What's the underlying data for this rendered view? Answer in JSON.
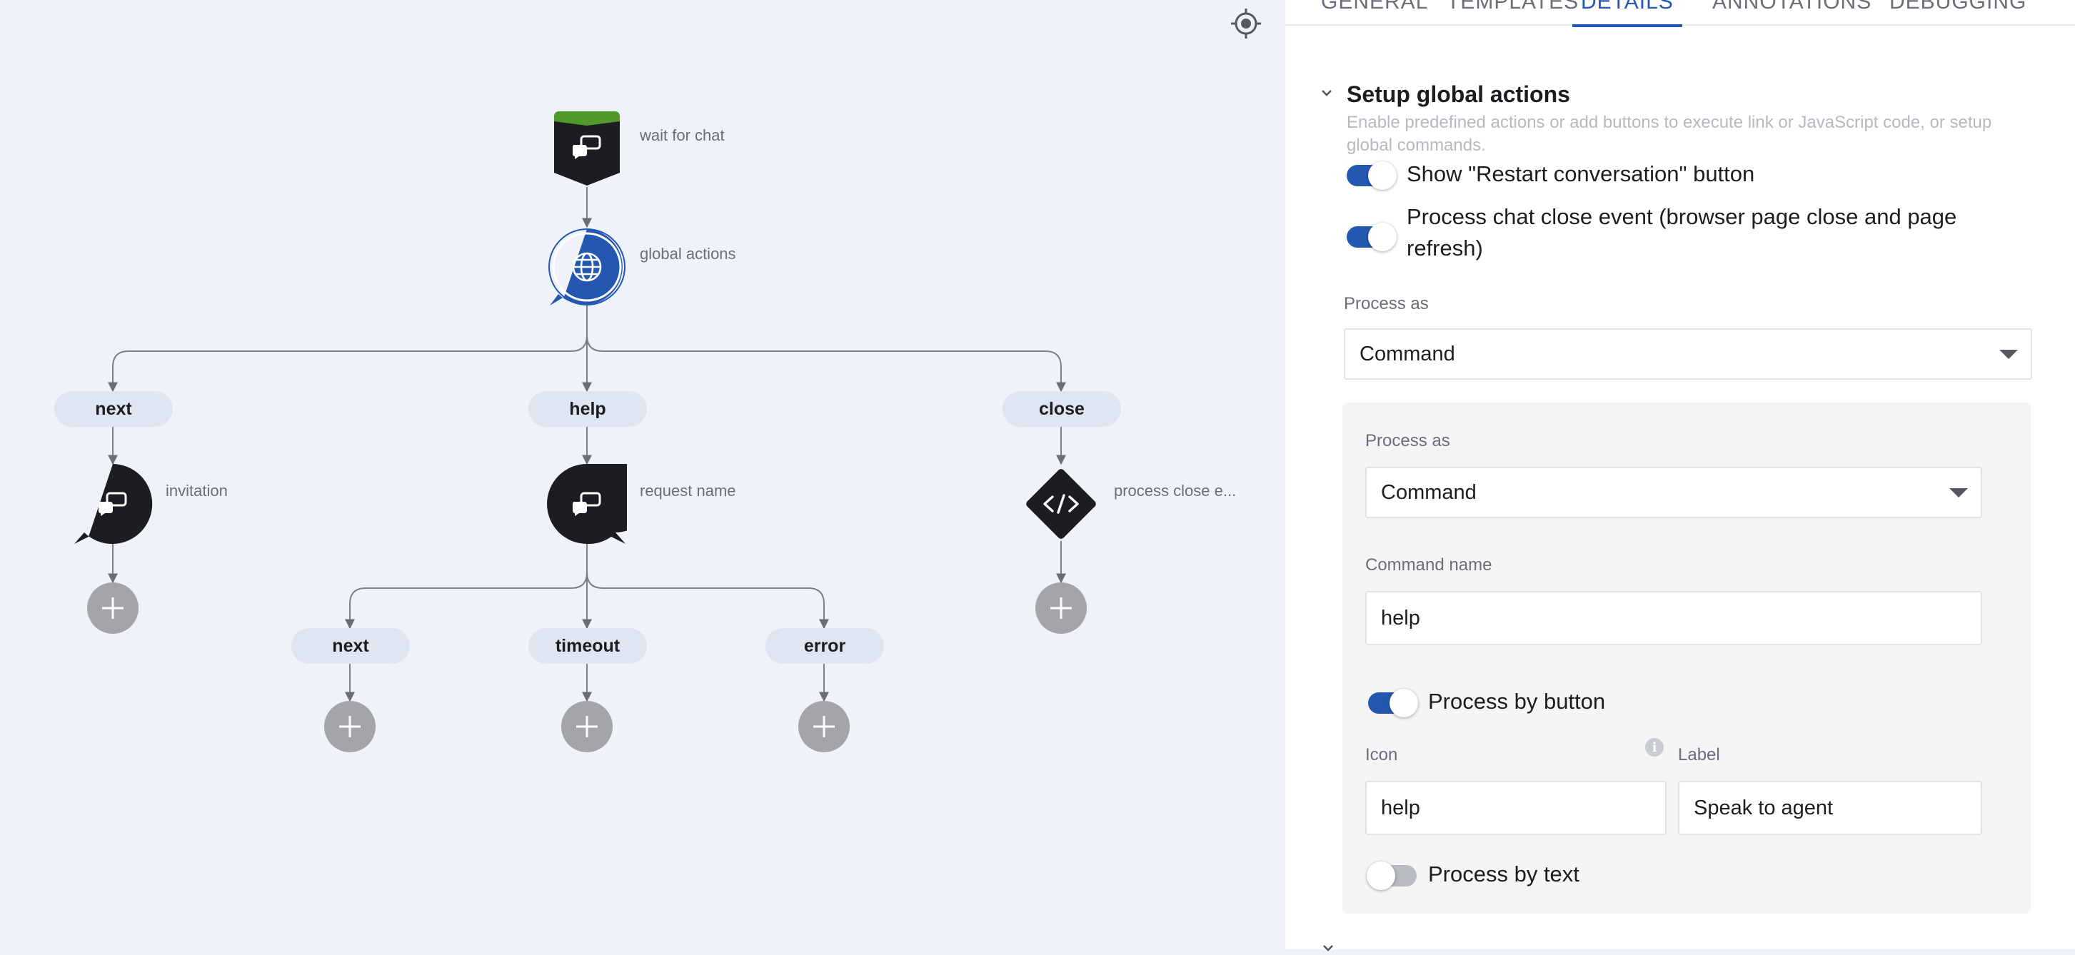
{
  "canvas": {
    "nodes": {
      "wait_for_chat": "wait for chat",
      "global_actions": "global actions",
      "invitation": "invitation",
      "request_name": "request name",
      "process_close": "process close e..."
    },
    "branches": {
      "next": "next",
      "help": "help",
      "close": "close",
      "next2": "next",
      "timeout": "timeout",
      "error": "error"
    },
    "icons": {
      "chat": "chat-bubbles-icon",
      "globe": "globe-icon",
      "code": "code-icon",
      "add": "plus-icon",
      "target": "crosshair-icon"
    },
    "colors": {
      "canvas_bg": "#eff2f9",
      "node_dark": "#1c1d21",
      "node_blue": "#2458b0",
      "start_accent": "#4f9a2a",
      "add_gray": "#a3a5aa"
    }
  },
  "panel": {
    "tabs": [
      "GENERAL",
      "TEMPLATES",
      "DETAILS",
      "ANNOTATIONS",
      "DEBUGGING"
    ],
    "active_tab": "DETAILS",
    "section": {
      "title": "Setup global actions",
      "description": "Enable predefined actions or add buttons to execute link or JavaScript code, or setup global commands."
    },
    "toggles": {
      "restart_label": "Show \"Restart conversation\" button",
      "restart_on": true,
      "close_event_label": "Process chat close event (browser page close and page refresh)",
      "close_event_on": true
    },
    "process_as_outer": {
      "label": "Process as",
      "value": "Command"
    },
    "command_card": {
      "process_as_label": "Process as",
      "process_as_value": "Command",
      "command_name_label": "Command name",
      "command_name_value": "help",
      "process_by_button_label": "Process by button",
      "process_by_button_on": true,
      "icon_label": "Icon",
      "icon_value": "help",
      "info_glyph": "i",
      "label_label": "Label",
      "label_value": "Speak to agent",
      "process_by_text_label": "Process by text",
      "process_by_text_on": false
    }
  }
}
